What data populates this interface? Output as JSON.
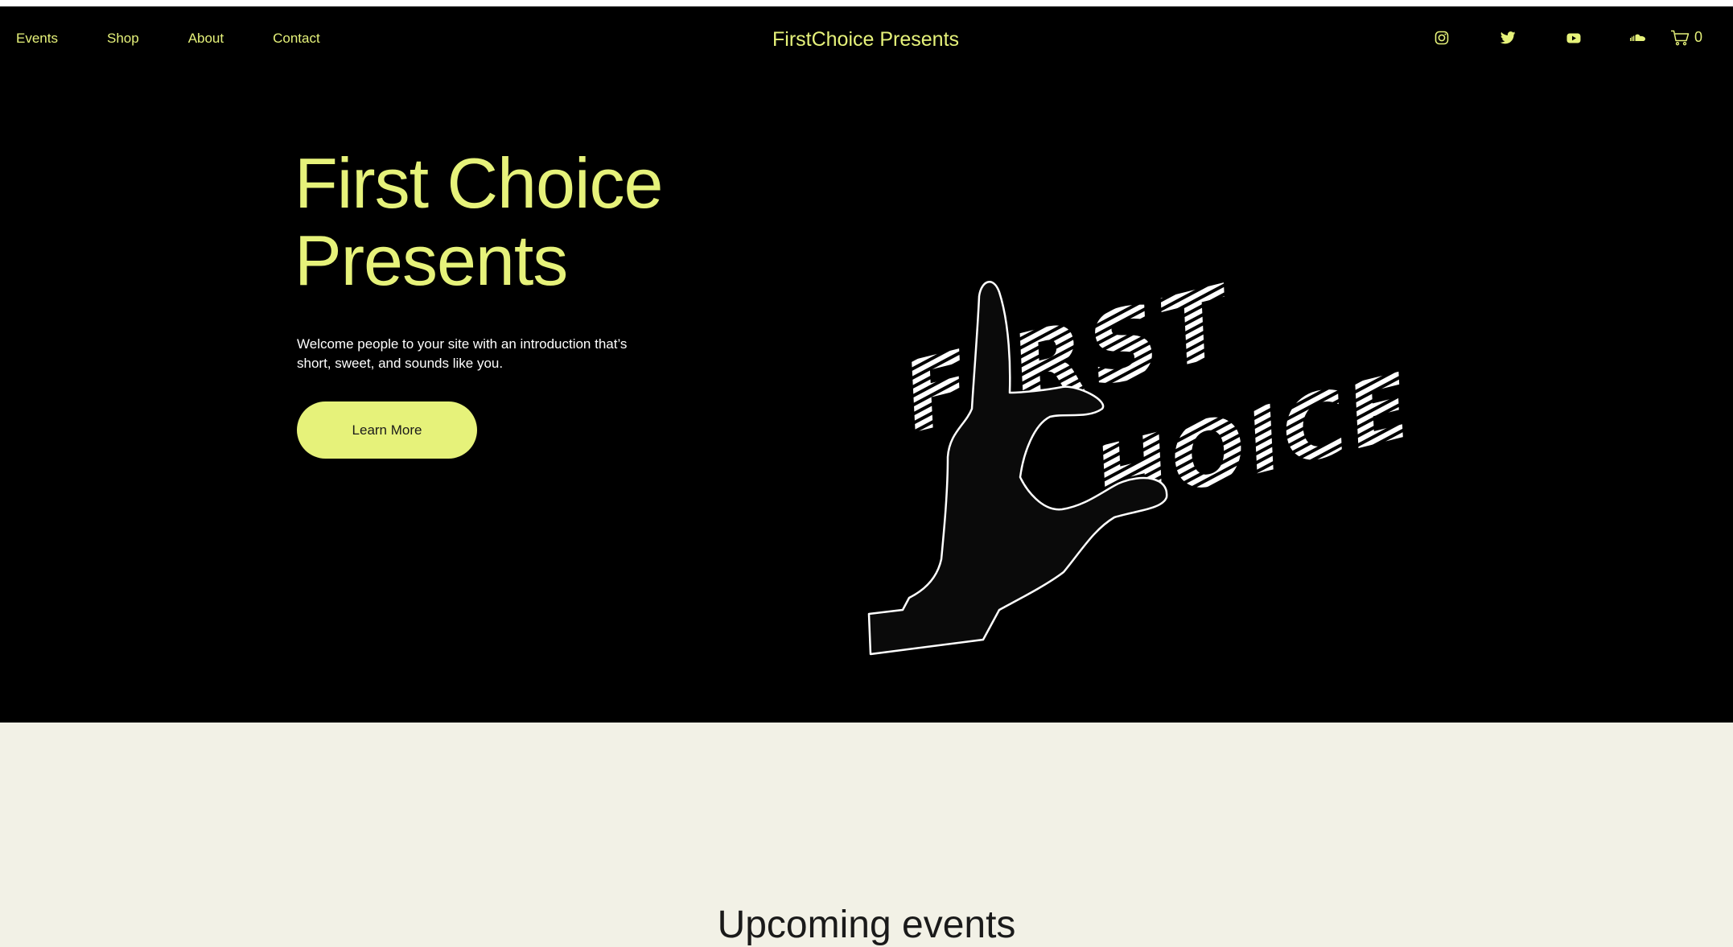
{
  "nav": {
    "links": [
      {
        "label": "Events"
      },
      {
        "label": "Shop"
      },
      {
        "label": "About"
      },
      {
        "label": "Contact"
      }
    ],
    "site_title": "FirstChoice Presents",
    "social_icons": [
      "instagram-icon",
      "twitter-icon",
      "youtube-icon",
      "soundcloud-icon"
    ],
    "cart_count": "0"
  },
  "hero": {
    "title_line1": "First Choice",
    "title_line2": "Presents",
    "intro_line1": "Welcome people to your site with an introduction that’s",
    "intro_line2": "short, sweet, and sounds like you.",
    "cta_label": "Learn More",
    "logo_text": "FIRST CHOICE"
  },
  "events": {
    "heading": "Upcoming events"
  },
  "colors": {
    "accent": "#e6f27a",
    "hero_bg": "#000000",
    "page_bg": "#f2f1e6",
    "text_dark": "#1a1a1a"
  }
}
